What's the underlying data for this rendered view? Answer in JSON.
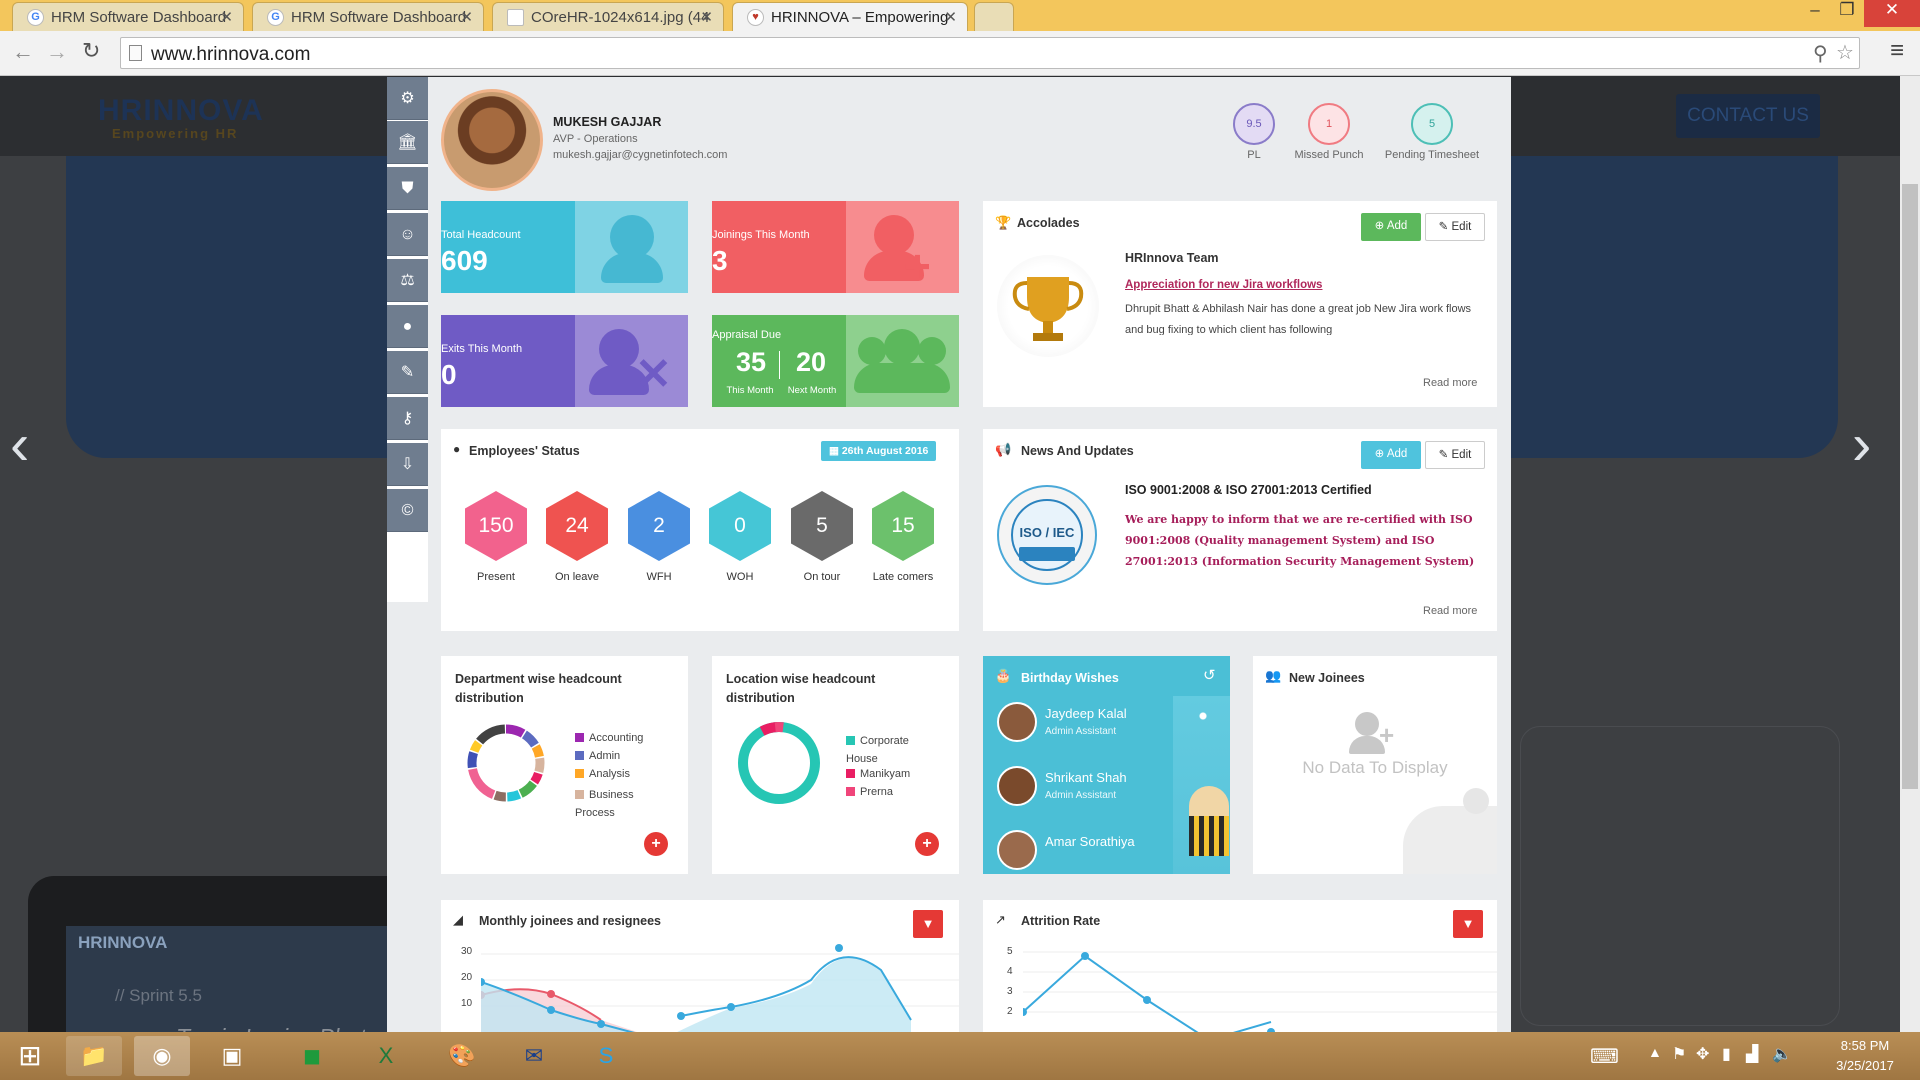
{
  "browser": {
    "tabs": [
      {
        "title": "HRM Software Dashboard",
        "fav": "G"
      },
      {
        "title": "HRM Software Dashboard",
        "fav": "G"
      },
      {
        "title": "COreHR-1024x614.jpg (44",
        "fav": ""
      },
      {
        "title": "HRINNOVA – Empowering",
        "fav": ""
      }
    ],
    "url": "www.hrinnova.com"
  },
  "background": {
    "logo": "HRINNOVA",
    "tagline": "Empowering HR",
    "contact": "CONTACT US",
    "sprint": "// Sprint 5.5",
    "watermark": "Tracie Louise Photography",
    "mini_logo": "HRINNOVA"
  },
  "profile": {
    "name": "MUKESH GAJJAR",
    "title": "AVP - Operations",
    "email": "mukesh.gajjar@cygnetinfotech.com"
  },
  "counters": [
    {
      "value": "9.5",
      "label": "PL",
      "color": "#8a7cc9",
      "bg": "#e3dbf4"
    },
    {
      "value": "1",
      "label": "Missed Punch",
      "color": "#f07b82",
      "bg": "#fde3e5"
    },
    {
      "value": "5",
      "label": "Pending Timesheet",
      "color": "#4dbfb6",
      "bg": "#d5f1ee"
    }
  ],
  "stats": {
    "headcount": {
      "label": "Total Headcount",
      "value": "609"
    },
    "joinings": {
      "label": "Joinings This Month",
      "value": "3"
    },
    "exits": {
      "label": "Exits This Month",
      "value": "0"
    },
    "appraisal": {
      "label": "Appraisal Due",
      "this_value": "35",
      "next_value": "20",
      "this_label": "This Month",
      "next_label": "Next Month"
    }
  },
  "accolades": {
    "title": "Accolades",
    "add": "Add",
    "edit": "Edit",
    "team": "HRInnova Team",
    "link": "Appreciation for new Jira workflows",
    "text": "Dhrupit Bhatt & Abhilash Nair  has done a great job New Jira work flows and bug fixing to which client has following",
    "more": "Read more"
  },
  "status": {
    "title": "Employees' Status",
    "date": "26th August 2016",
    "items": [
      {
        "value": "150",
        "label": "Present",
        "color": "#f2628d"
      },
      {
        "value": "24",
        "label": "On leave",
        "color": "#ef5350"
      },
      {
        "value": "2",
        "label": "WFH",
        "color": "#4a8fe0"
      },
      {
        "value": "0",
        "label": "WOH",
        "color": "#45c6d6"
      },
      {
        "value": "5",
        "label": "On tour",
        "color": "#6a6a6a"
      },
      {
        "value": "15",
        "label": "Late comers",
        "color": "#6cc16c"
      }
    ]
  },
  "news": {
    "title": "News And Updates",
    "add": "Add",
    "edit": "Edit",
    "headline": "ISO 9001:2008 & ISO 27001:2013 Certified",
    "body": "We are happy to inform that we are re-certified with ISO 9001:2008 (Quality management System) and ISO 27001:2013 (Information Security Management System)",
    "more": "Read more",
    "badge": "ISO / IEC"
  },
  "dept": {
    "title": "Department wise headcount distribution",
    "legend": [
      {
        "name": "Accounting",
        "color": "#9c27b0"
      },
      {
        "name": "Admin",
        "color": "#5c6bc0"
      },
      {
        "name": "Analysis",
        "color": "#ffa726"
      },
      {
        "name": "Business Process",
        "color": "#d7b49e"
      }
    ]
  },
  "location": {
    "title": "Location wise headcount distribution",
    "legend": [
      {
        "name": "Corporate House",
        "color": "#26c6b4"
      },
      {
        "name": "Manikyam",
        "color": "#e91e63"
      },
      {
        "name": "Prerna",
        "color": "#f0457a"
      }
    ]
  },
  "birthday": {
    "title": "Birthday Wishes",
    "people": [
      {
        "name": "Jaydeep Kalal",
        "role": "Admin Assistant"
      },
      {
        "name": "Shrikant Shah",
        "role": "Admin Assistant"
      },
      {
        "name": "Amar Sorathiya",
        "role": ""
      }
    ]
  },
  "joinees": {
    "title": "New Joinees",
    "empty": "No Data To Display"
  },
  "monthly": {
    "title": "Monthly joinees and resignees",
    "yticks": [
      "30",
      "20",
      "10"
    ]
  },
  "attrition": {
    "title": "Attrition Rate",
    "yticks": [
      "5",
      "4",
      "3",
      "2"
    ]
  },
  "taskbar": {
    "time": "8:58 PM",
    "date": "3/25/2017"
  }
}
